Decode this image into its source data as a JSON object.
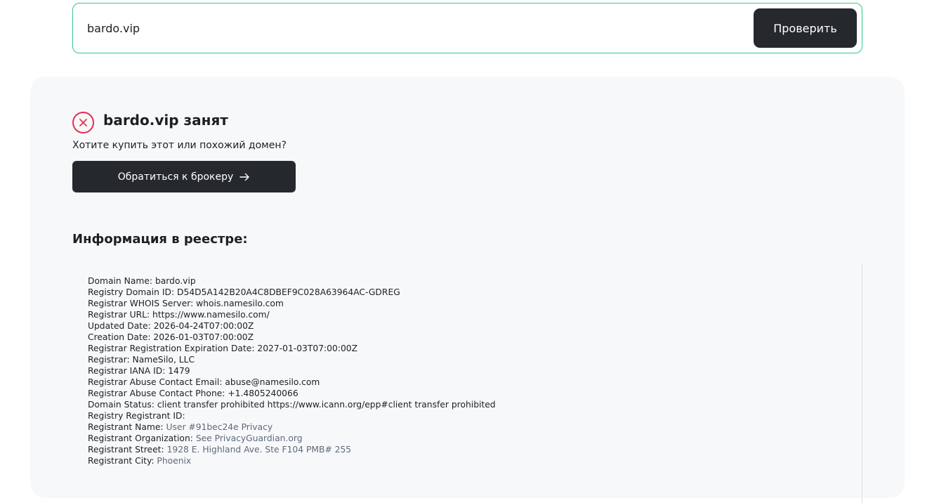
{
  "search": {
    "value": "bardo.vip",
    "button_label": "Проверить"
  },
  "result": {
    "status_title": "bardo.vip занят",
    "status_icon": "close-circle-icon",
    "buy_question": "Хотите купить этот или похожий домен?",
    "broker_button_label": "Обратиться к брокеру",
    "broker_icon": "arrow-right-icon"
  },
  "registry": {
    "heading": "Информация в реестре:",
    "lines": [
      {
        "key": "Domain Name:",
        "value": "bardo.vip",
        "muted": false
      },
      {
        "key": "Registry Domain ID:",
        "value": "D54D5A142B20A4C8DBEF9C028A63964AC-GDREG",
        "muted": false
      },
      {
        "key": "Registrar WHOIS Server:",
        "value": "whois.namesilo.com",
        "muted": false
      },
      {
        "key": "Registrar URL:",
        "value": "https://www.namesilo.com/",
        "muted": false
      },
      {
        "key": "Updated Date:",
        "value": "2026-04-24T07:00:00Z",
        "muted": false
      },
      {
        "key": "Creation Date:",
        "value": "2026-01-03T07:00:00Z",
        "muted": false
      },
      {
        "key": "Registrar Registration Expiration Date:",
        "value": "2027-01-03T07:00:00Z",
        "muted": false
      },
      {
        "key": "Registrar:",
        "value": "NameSilo, LLC",
        "muted": false
      },
      {
        "key": "Registrar IANA ID:",
        "value": "1479",
        "muted": false
      },
      {
        "key": "Registrar Abuse Contact Email:",
        "value": "abuse@namesilo.com",
        "muted": false
      },
      {
        "key": "Registrar Abuse Contact Phone:",
        "value": "+1.4805240066",
        "muted": false
      },
      {
        "key": "Domain Status:",
        "value": "client transfer prohibited https://www.icann.org/epp#client transfer prohibited",
        "muted": false
      },
      {
        "key": "Registry Registrant ID:",
        "value": "",
        "muted": false
      },
      {
        "key": "Registrant Name:",
        "value": "User #91bec24e Privacy",
        "muted": true
      },
      {
        "key": "Registrant Organization:",
        "value": "See PrivacyGuardian.org",
        "muted": true
      },
      {
        "key": "Registrant Street:",
        "value": "1928 E. Highland Ave. Ste F104 PMB# 255",
        "muted": true
      },
      {
        "key": "Registrant City:",
        "value": "Phoenix",
        "muted": true
      }
    ]
  }
}
